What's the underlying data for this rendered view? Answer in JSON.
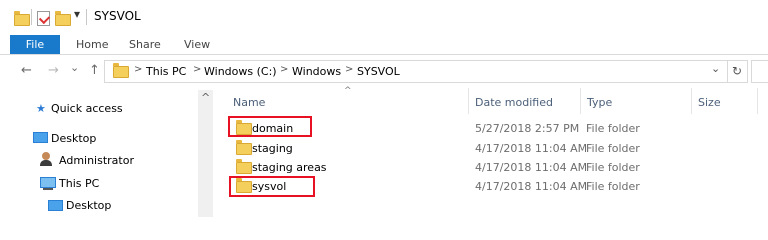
{
  "window": {
    "title": "SYSVOL"
  },
  "ribbon": {
    "tabs": [
      "File",
      "Home",
      "Share",
      "View"
    ]
  },
  "address": {
    "breadcrumb": [
      "This PC",
      "Windows (C:)",
      "Windows",
      "SYSVOL"
    ],
    "separator": ">"
  },
  "nav": {
    "quick_access": "Quick access",
    "desktop": "Desktop",
    "administrator": "Administrator",
    "this_pc": "This PC",
    "desktop_sub": "Desktop"
  },
  "columns": {
    "name": "Name",
    "date": "Date modified",
    "type": "Type",
    "size": "Size"
  },
  "rows": [
    {
      "name": "domain",
      "date": "5/27/2018 2:57 PM",
      "type": "File folder",
      "highlighted": true
    },
    {
      "name": "staging",
      "date": "4/17/2018 11:04 AM",
      "type": "File folder",
      "highlighted": false
    },
    {
      "name": "staging areas",
      "date": "4/17/2018 11:04 AM",
      "type": "File folder",
      "highlighted": false
    },
    {
      "name": "sysvol",
      "date": "4/17/2018 11:04 AM",
      "type": "File folder",
      "highlighted": true
    }
  ],
  "icons": {
    "back": "←",
    "forward": "→",
    "dropdown": "⌄",
    "up": "↑",
    "refresh": "↻",
    "collapse": "^",
    "scroll_up": "^"
  },
  "colors": {
    "accent": "#1979ca",
    "highlight_box": "#e81123",
    "folder": "#f5cf5b"
  }
}
